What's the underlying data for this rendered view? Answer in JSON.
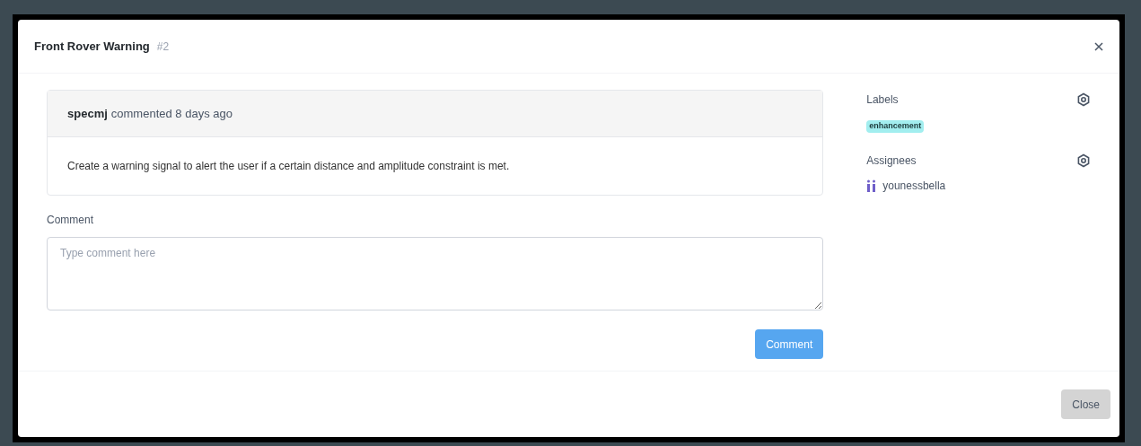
{
  "modal": {
    "title": "Front Rover Warning",
    "number": "#2"
  },
  "comment": {
    "author": "specmj",
    "meta": "commented 8 days ago",
    "body": "Create a warning signal to alert the user if a certain distance and amplitude constraint is met."
  },
  "comment_form": {
    "label": "Comment",
    "placeholder": "Type comment here",
    "button": "Comment"
  },
  "sidebar": {
    "labels": {
      "heading": "Labels",
      "items": [
        {
          "text": "enhancement",
          "color": "#a2eeef"
        }
      ]
    },
    "assignees": {
      "heading": "Assignees",
      "items": [
        "younessbella"
      ]
    }
  },
  "footer": {
    "button": "Close"
  }
}
